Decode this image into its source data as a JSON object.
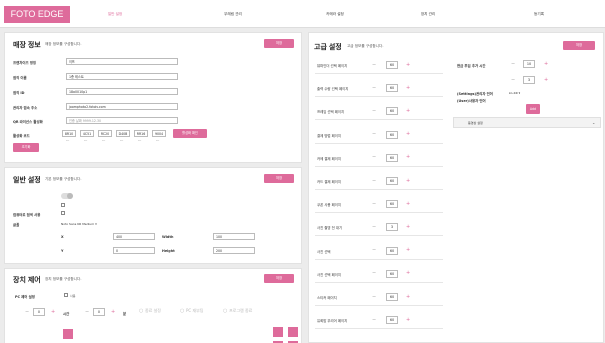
{
  "app": {
    "logo": "FOTO EDGE"
  },
  "nav": [
    {
      "label": "일반 설정",
      "active": true
    },
    {
      "label": "무레림 관리",
      "active": false
    },
    {
      "label": "카메라 설정",
      "active": false
    },
    {
      "label": "장치 관리",
      "active": false
    },
    {
      "label": "등기록",
      "active": false
    }
  ],
  "store": {
    "title": "매장 정보",
    "subtitle": "매장 정보를 구성합니다.",
    "save": "저장",
    "fields": [
      {
        "label": "프랜차이즈 명칭",
        "value": "이프"
      },
      {
        "label": "점직 이름",
        "value": "1층 테스트"
      },
      {
        "label": "점직 ID",
        "value": "18a0010p1"
      },
      {
        "label": "관리자 접속 주소",
        "value": "joomphoto2.fotoiv.com"
      },
      {
        "label": "QR 라이선스 활성화",
        "placeholder": "인증 날짜 9999.12.30"
      }
    ],
    "codes_label": "활성화 코드",
    "codes": [
      "8R10",
      "4C51",
      "RC20",
      "D40B",
      "RR16",
      "9004"
    ],
    "codes_sub": [
      "---",
      "---",
      "---",
      "---",
      "---",
      "---"
    ],
    "verify": "활성화 확인",
    "init": "초기화"
  },
  "general": {
    "title": "일반 설정",
    "subtitle": "기본 정보를 구성합니다.",
    "save": "저장",
    "camera_use": "컴퓨터로 점색 사용",
    "font_label": "글꼴",
    "font_value": "Noto Sans KR Medium",
    "x_label": "X",
    "x_value": "400",
    "y_label": "Y",
    "y_value": "0",
    "width_label": "Width",
    "width_value": "100",
    "height_label": "Height",
    "height_value": "200"
  },
  "device": {
    "title": "장치 제어",
    "subtitle": "장치 정보를 구성합니다.",
    "save": "저장",
    "pc_label": "PC 제어 설정",
    "pc_check": "사용",
    "stepper1": "0",
    "hour_label": "시간",
    "stepper2": "0",
    "minute_label": "분",
    "radios": [
      "종료 설정",
      "PC 재부팅",
      "프로그램 종료"
    ]
  },
  "advanced": {
    "title": "고급 설정",
    "subtitle": "고급 정보를 구성합니다.",
    "save": "저장",
    "rows": [
      {
        "label": "뷰파인더 선택 페이지",
        "value": "60"
      },
      {
        "label": "출력 수량 선택 페이지",
        "value": "60"
      },
      {
        "label": "프레임 선택 페이지",
        "value": "60"
      },
      {
        "label": "결제 방법 페이지",
        "value": "60"
      },
      {
        "label": "카메 결제 페이지",
        "value": "60"
      },
      {
        "label": "카드 결제 페이지",
        "value": "60"
      },
      {
        "label": "쿠폰 사용 페이지",
        "value": "60"
      },
      {
        "label": "사진 촬영 전 대기",
        "value": "3"
      },
      {
        "label": "사진 선택",
        "value": "60"
      },
      {
        "label": "사진 선택 페이지",
        "value": "60"
      },
      {
        "label": "스티커 페이지",
        "value": "60"
      },
      {
        "label": "유희맘 무리어 페이지",
        "value": "60"
      }
    ],
    "cash_label": "현금 투입 추가 시간",
    "cash_value1": "10",
    "cash_value2": "3",
    "settings_lang_label": "(Settings)관리자 언어",
    "settings_lang_value": "ko-KR",
    "user_lang_label": "(User)사용자 언어",
    "add_button": "Add",
    "video_label": "동영상 설정"
  }
}
